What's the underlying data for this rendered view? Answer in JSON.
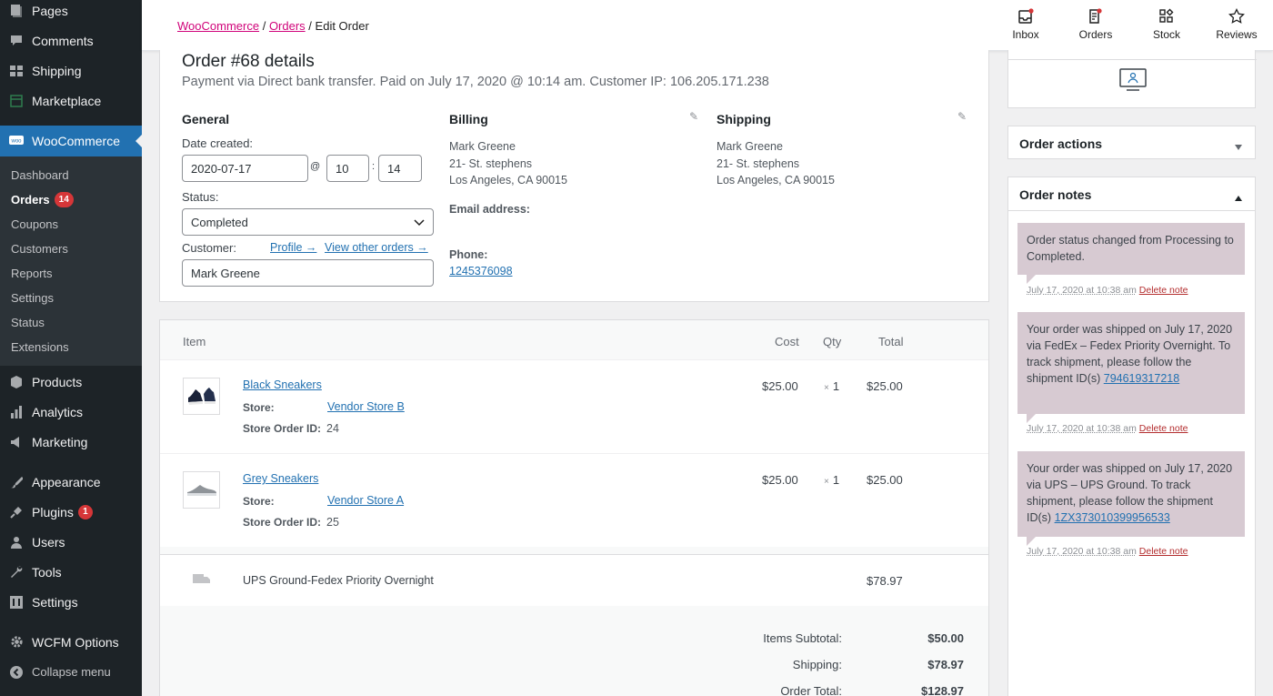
{
  "sidebar": {
    "items_top": [
      {
        "label": "Pages",
        "icon": "pages-icon"
      },
      {
        "label": "Comments",
        "icon": "comments-icon"
      },
      {
        "label": "Shipping",
        "icon": "shipping-icon"
      },
      {
        "label": "Marketplace",
        "icon": "marketplace-icon"
      }
    ],
    "active": {
      "label": "WooCommerce",
      "icon": "woocommerce-icon"
    },
    "submenu": [
      {
        "label": "Dashboard"
      },
      {
        "label": "Orders",
        "badge": "14"
      },
      {
        "label": "Coupons"
      },
      {
        "label": "Customers"
      },
      {
        "label": "Reports"
      },
      {
        "label": "Settings"
      },
      {
        "label": "Status"
      },
      {
        "label": "Extensions"
      }
    ],
    "items_bottom": [
      {
        "label": "Products",
        "icon": "products-icon"
      },
      {
        "label": "Analytics",
        "icon": "analytics-icon"
      },
      {
        "label": "Marketing",
        "icon": "marketing-icon"
      },
      {
        "label": "Appearance",
        "icon": "appearance-icon"
      },
      {
        "label": "Plugins",
        "icon": "plugins-icon",
        "badge": "1"
      },
      {
        "label": "Users",
        "icon": "users-icon"
      },
      {
        "label": "Tools",
        "icon": "tools-icon"
      },
      {
        "label": "Settings",
        "icon": "settings-icon"
      },
      {
        "label": "WCFM Options",
        "icon": "wcfm-icon"
      },
      {
        "label": "Collapse menu",
        "icon": "collapse-icon"
      }
    ]
  },
  "topbar": {
    "breadcrumb": {
      "root": "WooCommerce",
      "sep1": "/",
      "orders": "Orders",
      "sep2": "/",
      "current": "Edit Order"
    },
    "actions": {
      "inbox": "Inbox",
      "orders": "Orders",
      "stock": "Stock",
      "reviews": "Reviews"
    }
  },
  "order": {
    "title": "Order #68 details",
    "subtitle": "Payment via Direct bank transfer. Paid on July 17, 2020 @ 10:14 am. Customer IP: 106.205.171.238",
    "general": {
      "heading": "General",
      "date_label": "Date created:",
      "date": "2020-07-17",
      "at": "@",
      "hour": "10",
      "colon": ":",
      "minute": "14",
      "status_label": "Status:",
      "status": "Completed",
      "customer_label": "Customer:",
      "profile_link": "Profile →",
      "other_orders_link": "View other orders →",
      "customer": "Mark Greene"
    },
    "billing": {
      "heading": "Billing",
      "name": "Mark Greene",
      "street": "21- St. stephens",
      "city": "Los Angeles, CA 90015",
      "email_label": "Email address:",
      "phone_label": "Phone:",
      "phone": "1245376098"
    },
    "shipping": {
      "heading": "Shipping",
      "name": "Mark Greene",
      "street": "21- St. stephens",
      "city": "Los Angeles, CA 90015"
    }
  },
  "items": {
    "headers": {
      "item": "Item",
      "cost": "Cost",
      "qty": "Qty",
      "total": "Total"
    },
    "rows": [
      {
        "name": "Black Sneakers",
        "store_label": "Store:",
        "store": "Vendor Store B",
        "store_order_label": "Store Order ID:",
        "store_order_id": "24",
        "cost": "$25.00",
        "qty_x": "×",
        "qty": "1",
        "total": "$25.00"
      },
      {
        "name": "Grey Sneakers",
        "store_label": "Store:",
        "store": "Vendor Store A",
        "store_order_label": "Store Order ID:",
        "store_order_id": "25",
        "cost": "$25.00",
        "qty_x": "×",
        "qty": "1",
        "total": "$25.00"
      }
    ],
    "shipping_row": {
      "name": "UPS Ground-Fedex Priority Overnight",
      "total": "$78.97"
    },
    "totals": {
      "subtotal_label": "Items Subtotal:",
      "subtotal": "$50.00",
      "shipping_label": "Shipping:",
      "shipping": "$78.97",
      "order_total_label": "Order Total:",
      "order_total": "$128.97"
    }
  },
  "side": {
    "order_actions": "Order actions",
    "order_notes": "Order notes",
    "notes": [
      {
        "text": "Order status changed from Processing to Completed.",
        "date": "July 17, 2020 at 10:38 am",
        "delete": "Delete note"
      },
      {
        "text": "Your order was shipped on July 17, 2020 via FedEx – Fedex Priority Overnight. To track shipment, please follow the shipment ID(s) ",
        "link": "794619317218",
        "date": "July 17, 2020 at 10:38 am",
        "delete": "Delete note"
      },
      {
        "text": "Your order was shipped on July 17, 2020 via UPS – UPS Ground. To track shipment, please follow the shipment ID(s) ",
        "link": "1ZX373010399956533",
        "date": "July 17, 2020 at 10:38 am",
        "delete": "Delete note"
      }
    ]
  },
  "colors": {
    "accent": "#2271b1",
    "sidebar_bg": "#1d2327",
    "note_bg": "#d7cad2",
    "badge": "#d63638",
    "breadcrumb_link": "#d0047a"
  }
}
